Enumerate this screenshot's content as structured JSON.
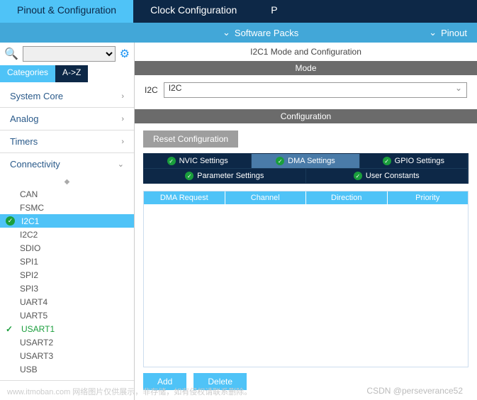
{
  "top_tabs": {
    "pinout": "Pinout & Configuration",
    "clock": "Clock Configuration",
    "p": "P"
  },
  "sub_bar": {
    "software_packs": "Software Packs",
    "pinout": "Pinout"
  },
  "search": {
    "placeholder": ""
  },
  "cat_tabs": {
    "categories": "Categories",
    "az": "A->Z"
  },
  "tree": {
    "system_core": "System Core",
    "analog": "Analog",
    "timers": "Timers",
    "connectivity": "Connectivity",
    "items": {
      "can": "CAN",
      "fsmc": "FSMC",
      "i2c1": "I2C1",
      "i2c2": "I2C2",
      "sdio": "SDIO",
      "spi1": "SPI1",
      "spi2": "SPI2",
      "spi3": "SPI3",
      "uart4": "UART4",
      "uart5": "UART5",
      "usart1": "USART1",
      "usart2": "USART2",
      "usart3": "USART3",
      "usb": "USB"
    }
  },
  "panel": {
    "title": "I2C1 Mode and Configuration",
    "mode_header": "Mode",
    "mode_label": "I2C",
    "mode_value": "I2C",
    "config_header": "Configuration",
    "reset": "Reset Configuration"
  },
  "cfg_tabs": {
    "nvic": "NVIC Settings",
    "dma": "DMA Settings",
    "gpio": "GPIO Settings",
    "param": "Parameter Settings",
    "user": "User Constants"
  },
  "dma": {
    "cols": {
      "req": "DMA Request",
      "channel": "Channel",
      "direction": "Direction",
      "priority": "Priority"
    },
    "add": "Add",
    "delete": "Delete"
  },
  "watermark": "CSDN @perseverance52",
  "watermark2": "www.itmoban.com 网络图片仅供展示，非存储，如有侵权请联系删除。"
}
